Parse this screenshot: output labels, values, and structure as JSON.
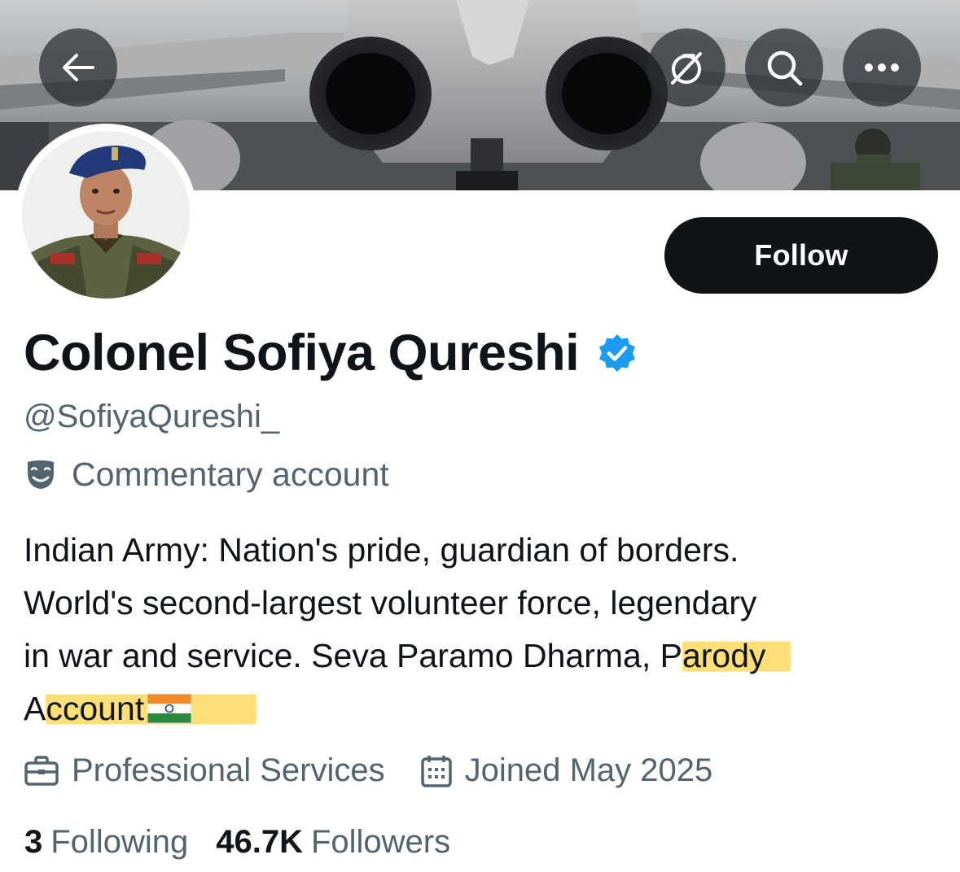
{
  "header": {
    "back_icon": "arrow-left-icon",
    "hide_icon": "eye-slash-icon",
    "search_icon": "search-icon",
    "more_icon": "more-horizontal-icon"
  },
  "profile": {
    "display_name": "Colonel Sofiya Qureshi",
    "verified_icon": "verified-badge-icon",
    "verified_color": "#1d9bf0",
    "handle": "@SofiyaQureshi_",
    "label": "Commentary account",
    "label_icon": "theater-masks-icon",
    "bio": {
      "line1": "Indian Army: Nation's pride, guardian of borders.",
      "line2": "World's second-largest volunteer force, legendary",
      "line3_prefix": "in war and service. Seva Paramo Dharma, P",
      "line3_highlight": "arody",
      "line4_prefix": "A",
      "line4_highlight": "ccount",
      "flag_icon": "india-flag-emoji",
      "highlight_color": "#ffd650"
    },
    "category": "Professional Services",
    "category_icon": "briefcase-icon",
    "joined": "Joined May 2025",
    "joined_icon": "calendar-icon"
  },
  "actions": {
    "follow_label": "Follow",
    "follow_bg": "#0f1419"
  },
  "stats": {
    "following_count": "3",
    "following_label": "Following",
    "followers_count": "46.7K",
    "followers_label": "Followers"
  }
}
